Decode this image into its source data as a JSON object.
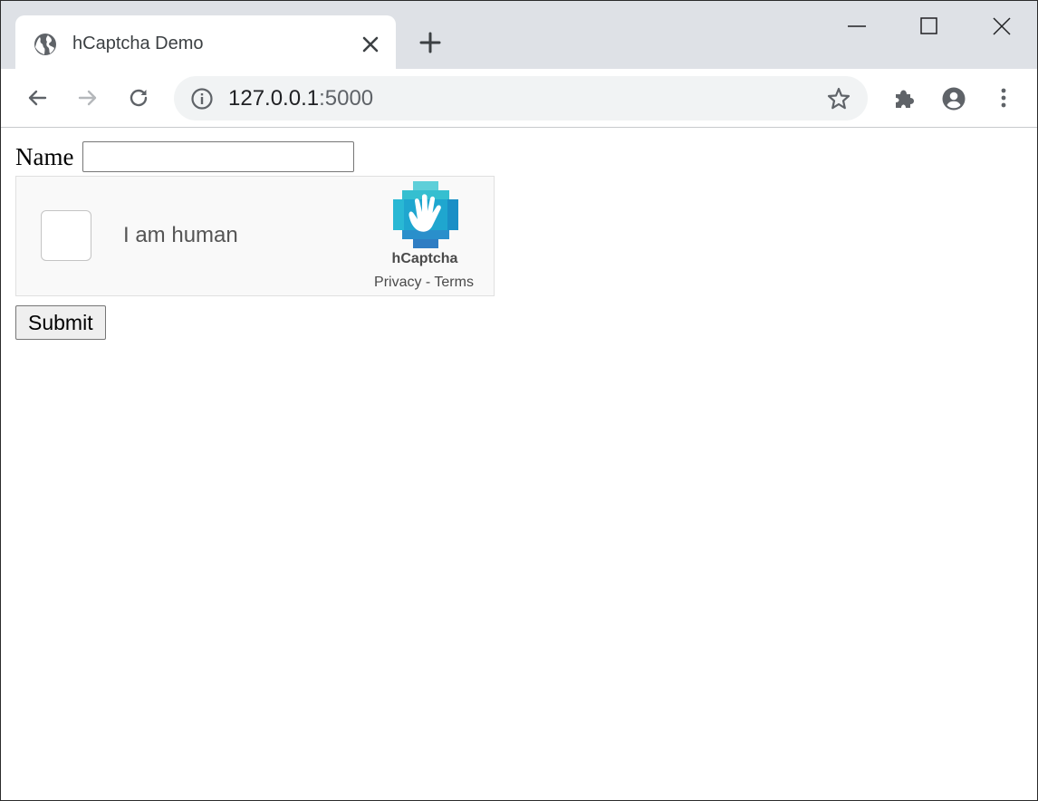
{
  "browser": {
    "tab": {
      "title": "hCaptcha Demo",
      "icon": "globe-icon"
    },
    "address_bar": {
      "host": "127.0.0.1",
      "port": ":5000",
      "icon": "info-icon"
    }
  },
  "form": {
    "name_label": "Name",
    "name_value": "",
    "captcha": {
      "checkbox_label": "I am human",
      "brand": "hCaptcha",
      "privacy_link": "Privacy",
      "separator": " - ",
      "terms_link": "Terms"
    },
    "submit_label": "Submit"
  },
  "colors": {
    "tabstrip": "#dee1e6",
    "omnibox": "#f1f3f4",
    "captcha_bg": "#f9f9f9",
    "hcaptcha_teal": "#1fbad1"
  }
}
